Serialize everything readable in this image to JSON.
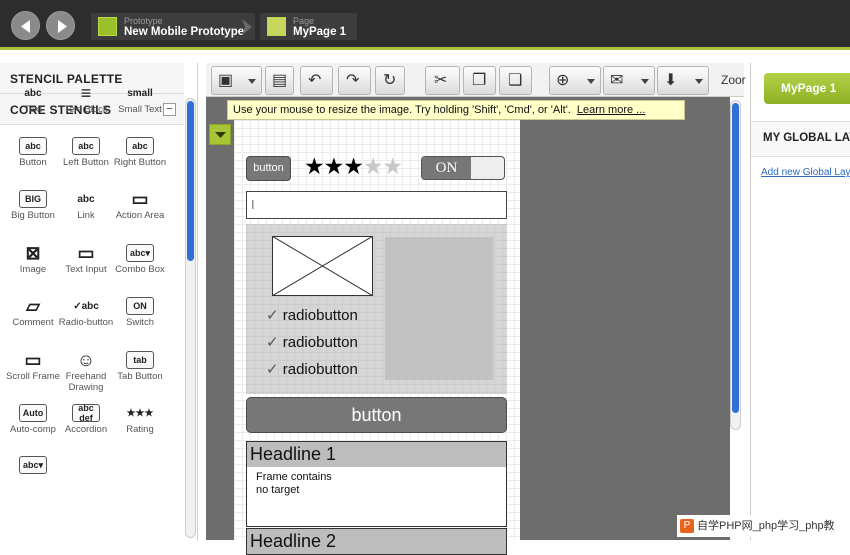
{
  "topbar": {
    "crumb_prototype": {
      "label": "Prototype",
      "value": "New Mobile Prototype"
    },
    "crumb_page": {
      "label": "Page",
      "value": "MyPage 1"
    }
  },
  "sidebar": {
    "title": "STENCIL PALETTE",
    "section": "CORE STENCILS",
    "stencils": [
      {
        "icon": "abc",
        "label": "Text"
      },
      {
        "icon": "text-block-icon",
        "label": "Text Block"
      },
      {
        "icon": "small",
        "label": "Small Text"
      },
      {
        "icon": "abc",
        "label": "Button"
      },
      {
        "icon": "abc",
        "label": "Left Button"
      },
      {
        "icon": "abc",
        "label": "Right Button"
      },
      {
        "icon": "BIG",
        "label": "Big Button"
      },
      {
        "icon": "abc",
        "label": "Link"
      },
      {
        "icon": "action-area-icon",
        "label": "Action Area"
      },
      {
        "icon": "image-icon",
        "label": "Image"
      },
      {
        "icon": "text-input-icon",
        "label": "Text Input"
      },
      {
        "icon": "abc▾",
        "label": "Combo Box"
      },
      {
        "icon": "comment-icon",
        "label": "Comment"
      },
      {
        "icon": "✓abc",
        "label": "Radio-button"
      },
      {
        "icon": "ON",
        "label": "Switch"
      },
      {
        "icon": "scroll-frame-icon",
        "label": "Scroll Frame"
      },
      {
        "icon": "freehand-icon",
        "label": "Freehand Drawing"
      },
      {
        "icon": "tab",
        "label": "Tab Button"
      },
      {
        "icon": "Auto",
        "label": "Auto-comp"
      },
      {
        "icon": "abc def",
        "label": "Accordion"
      },
      {
        "icon": "★★★",
        "label": "Rating"
      },
      {
        "icon": "abc▾",
        "label": ""
      }
    ]
  },
  "toolbar": {
    "zoom_label": "Zoor"
  },
  "tooltip": {
    "text": "Use your mouse to resize the image. Try holding 'Shift', 'Cmd', or 'Alt'.",
    "link": "Learn more ..."
  },
  "canvas": {
    "button_small": "button",
    "rating": {
      "filled": 3,
      "total": 5
    },
    "switch_label": "ON",
    "radio_items": [
      "radiobutton",
      "radiobutton",
      "radiobutton"
    ],
    "button_big": "button",
    "accordion": [
      {
        "headline": "Headline 1",
        "content": [
          "Frame contains",
          "no target"
        ]
      },
      {
        "headline": "Headline 2"
      }
    ]
  },
  "right_panel": {
    "page_button": "MyPage 1",
    "global_layers_title": "MY GLOBAL LAY",
    "add_global_link": "Add new Global Laye"
  },
  "watermark": {
    "icon": "P",
    "text": "自学PHP网_php学习_php教"
  },
  "colors": {
    "accent": "#a8c536",
    "scroll_blue": "#2f6fd6",
    "canvas_gray": "#6d6d6d"
  }
}
